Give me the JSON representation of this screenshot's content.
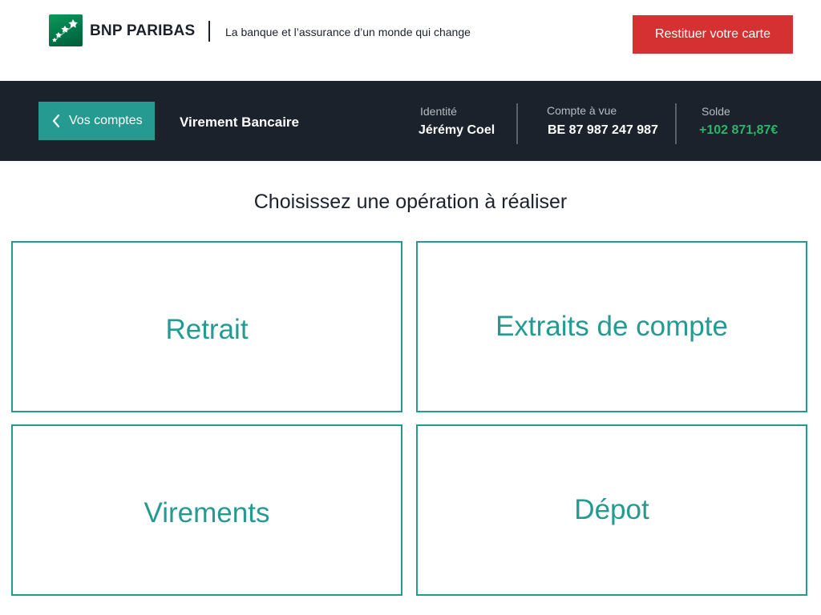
{
  "header": {
    "brand": "BNP PARIBAS",
    "tagline": "La banque et l’assurance d’un monde qui change",
    "return_card_label": "Restituer votre carte",
    "logo_icon": "bnp-stars-logo-icon"
  },
  "bar": {
    "back_label": "Vos comptes",
    "back_icon": "chevron-left-icon",
    "title": "Virement Bancaire",
    "identity": {
      "label": "Identité",
      "value": "Jérémy Coel"
    },
    "account": {
      "label": "Compte à vue",
      "value": "BE 87 987 247 987"
    },
    "balance": {
      "label": "Solde",
      "value": "+102 871,87€"
    }
  },
  "main": {
    "heading": "Choisissez une opération à réaliser",
    "operations": [
      {
        "label": "Retrait"
      },
      {
        "label": "Extraits de compte"
      },
      {
        "label": "Virements"
      },
      {
        "label": "Dépot"
      }
    ]
  },
  "colors": {
    "accent": "#249a90",
    "dark_bar": "#1b222c",
    "danger_button": "#d53132",
    "balance_positive": "#2fb36b",
    "logo_green": "#00774a"
  }
}
